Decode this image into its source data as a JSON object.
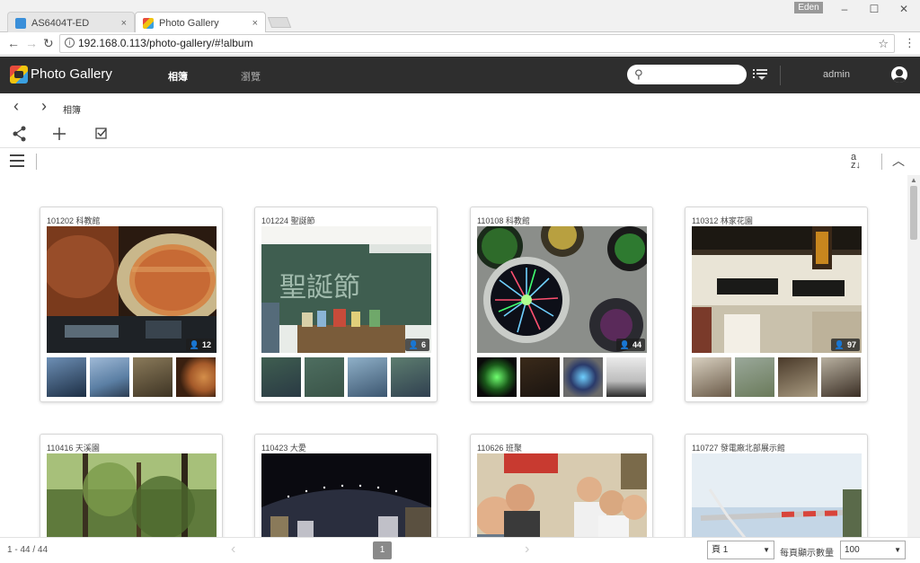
{
  "browser": {
    "tabs": [
      {
        "title": "AS6404T-ED",
        "active": false
      },
      {
        "title": "Photo Gallery",
        "active": true
      }
    ],
    "close_glyph": "×",
    "user": "Eden",
    "url": "192.168.0.113/photo-gallery/#!album",
    "icons": [
      "back-icon",
      "forward-icon",
      "reload-icon",
      "info-icon",
      "star-icon",
      "menu-dots-icon"
    ]
  },
  "app": {
    "title": "Photo Gallery",
    "nav": [
      {
        "label": "相簿",
        "active": true
      },
      {
        "label": "瀏覽",
        "active": false
      }
    ],
    "search": {
      "value": "",
      "placeholder": ""
    },
    "user": "admin"
  },
  "breadcrumb": {
    "current": "相簿"
  },
  "toolbar": {
    "icons": [
      "share-icon",
      "add-icon",
      "select-icon"
    ]
  },
  "albums": [
    {
      "title": "101202 科教館",
      "count": "12"
    },
    {
      "title": "101224 聖誕節",
      "count": "6"
    },
    {
      "title": "110108 科教館",
      "count": "44"
    },
    {
      "title": "110312 林家花園",
      "count": "97"
    },
    {
      "title": "110416 天溪園",
      "count": ""
    },
    {
      "title": "110423 大愛",
      "count": ""
    },
    {
      "title": "110626 班聚",
      "count": ""
    },
    {
      "title": "110727 發電廠北部展示館",
      "count": ""
    }
  ],
  "footer": {
    "range": "1 - 44 / 44",
    "current_page": "1",
    "page_select": "頁 1",
    "per_page_label": "每頁顯示數量",
    "per_page": "100"
  },
  "colors": {
    "header_bg": "#2e2e2e",
    "accent": "#ffffff"
  }
}
